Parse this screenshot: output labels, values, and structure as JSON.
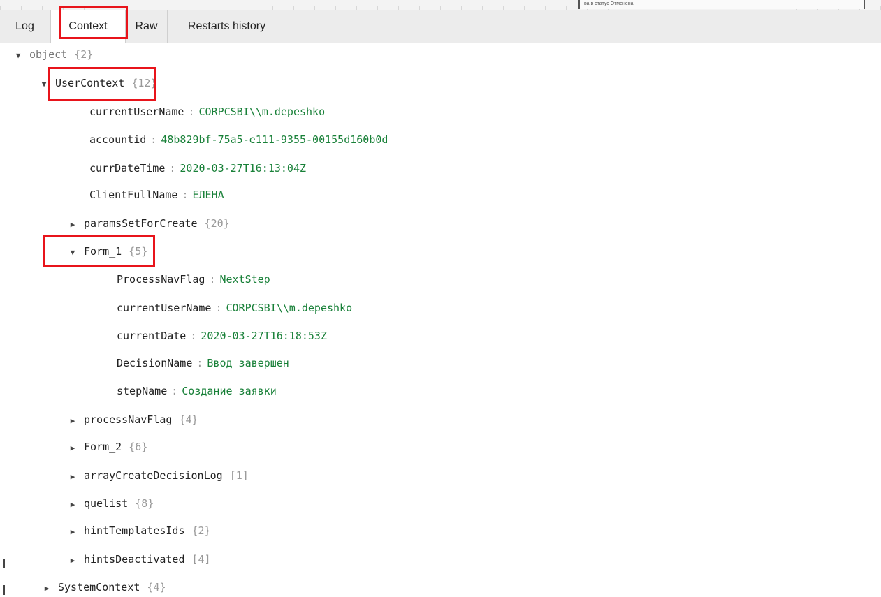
{
  "top_strip": {
    "note": "ва в статус Отменена"
  },
  "tabs": [
    {
      "label": "Log"
    },
    {
      "label": "Context"
    },
    {
      "label": "Raw"
    },
    {
      "label": "Restarts history"
    }
  ],
  "tree": {
    "root": {
      "key": "object",
      "count": "{2}"
    },
    "user_context": {
      "key": "UserContext",
      "count": "{12}",
      "items": [
        {
          "key": "currentUserName",
          "value": "CORPCSBI\\\\m.depeshko"
        },
        {
          "key": "accountid",
          "value": "48b829bf-75a5-e111-9355-00155d160b0d"
        },
        {
          "key": "currDateTime",
          "value": "2020-03-27T16:13:04Z"
        },
        {
          "key": "ClientFullName",
          "value": "ЕЛЕНА"
        }
      ],
      "params_set_for_create": {
        "key": "paramsSetForCreate",
        "count": "{20}"
      },
      "form_1": {
        "key": "Form_1",
        "count": "{5}",
        "items": [
          {
            "key": "ProcessNavFlag",
            "value": "NextStep"
          },
          {
            "key": "currentUserName",
            "value": "CORPCSBI\\\\m.depeshko"
          },
          {
            "key": "currentDate",
            "value": "2020-03-27T16:18:53Z"
          },
          {
            "key": "DecisionName",
            "value": "Ввод завершен"
          },
          {
            "key": "stepName",
            "value": "Создание заявки"
          }
        ]
      },
      "collapsed": [
        {
          "key": "processNavFlag",
          "count": "{4}"
        },
        {
          "key": "Form_2",
          "count": "{6}"
        },
        {
          "key": "arrayCreateDecisionLog",
          "count": "[1]"
        },
        {
          "key": "quelist",
          "count": "{8}"
        },
        {
          "key": "hintTemplatesIds",
          "count": "{2}"
        },
        {
          "key": "hintsDeactivated",
          "count": "[4]"
        }
      ]
    },
    "system_context": {
      "key": "SystemContext",
      "count": "{4}"
    }
  },
  "glyphs": {
    "expanded": "▼",
    "collapsed": "▶",
    "separator": ":"
  },
  "colors": {
    "value": "#188038",
    "count": "#999999",
    "highlight": "#e8141b"
  }
}
